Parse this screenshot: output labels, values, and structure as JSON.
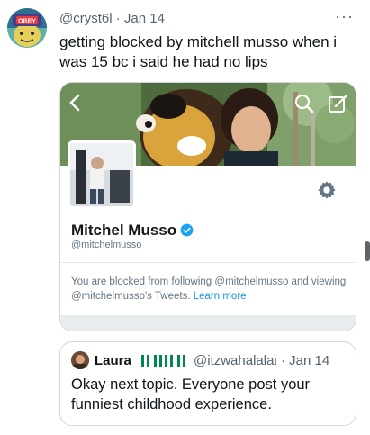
{
  "tweet": {
    "handle": "@cryst6l",
    "date": "Jan 14",
    "separator": "·",
    "more_label": "···",
    "avatar_text": "OBEY",
    "text": "getting blocked by mitchell musso when i was 15 bc i said he had no lips"
  },
  "screenshot": {
    "profile_name": "Mitchel Musso",
    "profile_handle": "@mitchelmusso",
    "blocked_text": "You are blocked from following @mitchelmusso and viewing @mitchelmusso's Tweets.",
    "learn_more": "Learn more",
    "icons": [
      "back-arrow-icon",
      "search-icon",
      "compose-icon",
      "gear-icon",
      "verified-badge-icon"
    ]
  },
  "quote": {
    "name": "Laura",
    "handle": "@itzwahalalaι",
    "date": "Jan 14",
    "separator": "·",
    "text": "Okay next topic. Everyone post your funniest childhood experience."
  },
  "colors": {
    "text": "#0f1419",
    "secondary": "#536471",
    "border": "#cfd9de",
    "link": "#1b95e0",
    "verified": "#1da1f2",
    "flag_green": "#008751"
  }
}
